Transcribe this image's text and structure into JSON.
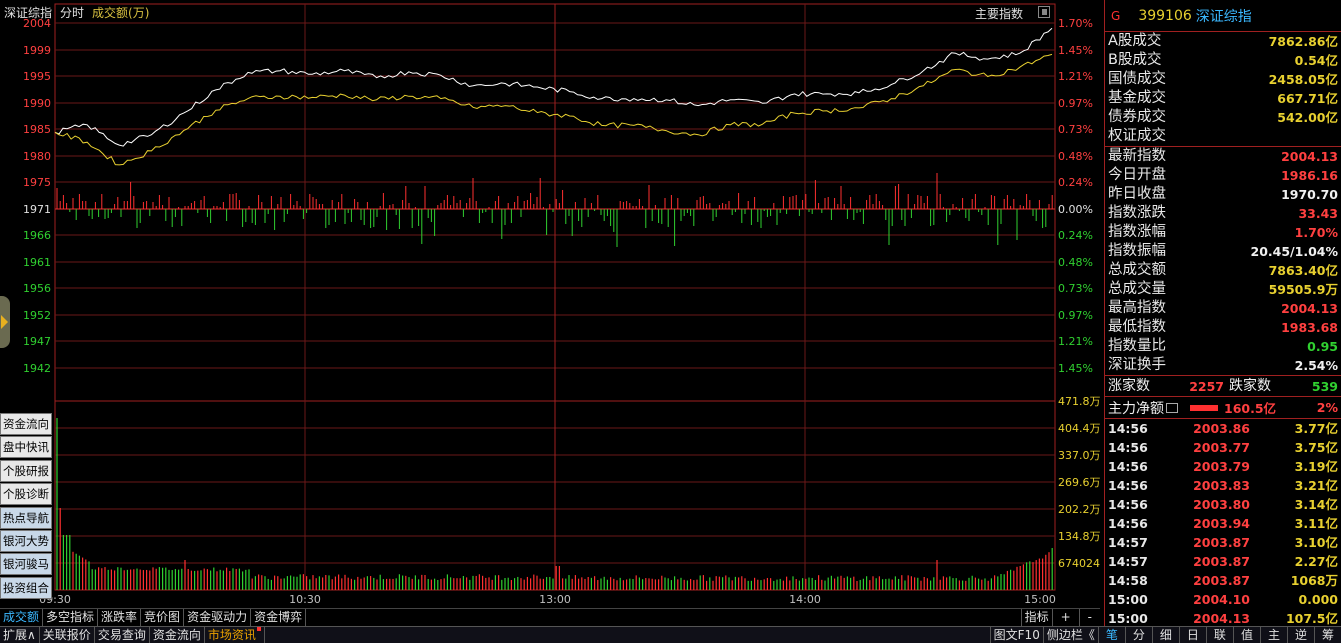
{
  "header": {
    "name": "深证综指",
    "period": "分时",
    "volume_label": "成交额(万)",
    "main_index_btn": "主要指数"
  },
  "price_axis": {
    "left": [
      "2004",
      "1999",
      "1995",
      "1990",
      "1985",
      "1980",
      "1975",
      "1971",
      "1966",
      "1961",
      "1956",
      "1952",
      "1947",
      "1942"
    ],
    "right": [
      "1.70%",
      "1.45%",
      "1.21%",
      "0.97%",
      "0.73%",
      "0.48%",
      "0.24%",
      "0.00%",
      "0.24%",
      "0.48%",
      "0.73%",
      "0.97%",
      "1.21%",
      "1.45%"
    ]
  },
  "volume_axis": {
    "right": [
      "471.8万",
      "404.4万",
      "337.0万",
      "269.6万",
      "202.2万",
      "134.8万",
      "674024"
    ]
  },
  "time_axis": [
    "09:30",
    "10:30",
    "13:00",
    "14:00",
    "15:00"
  ],
  "side_buttons": [
    "资金流向",
    "盘中快讯",
    "个股研报",
    "个股诊断",
    "热点导航",
    "银河大势",
    "银河骏马",
    "投资组合"
  ],
  "tabs": [
    "成交额",
    "多空指标",
    "涨跌率",
    "竞价图",
    "资金驱动力",
    "资金博弈"
  ],
  "tabs_right": [
    "指标",
    "+",
    "-"
  ],
  "bottom_bar": {
    "left": [
      "扩展∧",
      "关联报价",
      "交易查询",
      "资金流向",
      "市场资讯"
    ],
    "right": [
      "图文F10",
      "侧边栏《",
      "笔",
      "分",
      "细",
      "日",
      "联",
      "值",
      "主",
      "逆",
      "筹"
    ]
  },
  "security": {
    "flag": "G",
    "code": "399106",
    "name": "深证综指"
  },
  "turnover": [
    {
      "k": "A股成交",
      "v": "7862.86亿"
    },
    {
      "k": "B股成交",
      "v": "0.54亿"
    },
    {
      "k": "国债成交",
      "v": "2458.05亿"
    },
    {
      "k": "基金成交",
      "v": "667.71亿"
    },
    {
      "k": "债券成交",
      "v": "542.00亿"
    },
    {
      "k": "权证成交",
      "v": ""
    }
  ],
  "stats": [
    {
      "k": "最新指数",
      "v": "2004.13",
      "c": "r"
    },
    {
      "k": "今日开盘",
      "v": "1986.16",
      "c": "r"
    },
    {
      "k": "昨日收盘",
      "v": "1970.70",
      "c": "w"
    },
    {
      "k": "指数涨跌",
      "v": "33.43",
      "c": "r"
    },
    {
      "k": "指数涨幅",
      "v": "1.70%",
      "c": "r"
    },
    {
      "k": "指数振幅",
      "v": "20.45/1.04%",
      "c": "w"
    },
    {
      "k": "总成交额",
      "v": "7863.40亿",
      "c": "y"
    },
    {
      "k": "总成交量",
      "v": "59505.9万",
      "c": "y"
    },
    {
      "k": "最高指数",
      "v": "2004.13",
      "c": "r"
    },
    {
      "k": "最低指数",
      "v": "1983.68",
      "c": "r"
    },
    {
      "k": "指数量比",
      "v": "0.95",
      "c": "gr"
    },
    {
      "k": "深证换手",
      "v": "2.54%",
      "c": "w"
    }
  ],
  "breadth": {
    "up_label": "涨家数",
    "up": "2257",
    "down_label": "跌家数",
    "down": "539"
  },
  "main_flow": {
    "label": "主力净额",
    "value": "160.5亿",
    "pct": "2%"
  },
  "ticks": [
    {
      "t": "14:56",
      "p": "2003.86",
      "a": "3.77亿"
    },
    {
      "t": "14:56",
      "p": "2003.77",
      "a": "3.75亿"
    },
    {
      "t": "14:56",
      "p": "2003.79",
      "a": "3.19亿"
    },
    {
      "t": "14:56",
      "p": "2003.83",
      "a": "3.21亿"
    },
    {
      "t": "14:56",
      "p": "2003.80",
      "a": "3.14亿"
    },
    {
      "t": "14:56",
      "p": "2003.94",
      "a": "3.11亿"
    },
    {
      "t": "14:57",
      "p": "2003.87",
      "a": "3.10亿"
    },
    {
      "t": "14:57",
      "p": "2003.87",
      "a": "2.27亿"
    },
    {
      "t": "14:58",
      "p": "2003.87",
      "a": "1068万"
    },
    {
      "t": "15:00",
      "p": "2004.10",
      "a": "0.000"
    },
    {
      "t": "15:00",
      "p": "2004.13",
      "a": "107.5亿"
    }
  ],
  "chart_data": {
    "type": "line",
    "title": "深证综指 分时",
    "prev_close": 1970.7,
    "ylim": [
      1940,
      2005
    ],
    "series": [
      {
        "name": "index",
        "color": "#ffffff",
        "x": [
          "09:30",
          "09:35",
          "09:40",
          "09:45",
          "09:50",
          "09:55",
          "10:00",
          "10:05",
          "10:10",
          "10:15",
          "10:20",
          "10:25",
          "10:30",
          "10:40",
          "10:50",
          "11:00",
          "11:10",
          "11:20",
          "11:30",
          "13:00",
          "13:10",
          "13:20",
          "13:30",
          "13:40",
          "13:50",
          "14:00",
          "14:10",
          "14:20",
          "14:30",
          "14:40",
          "14:50",
          "15:00"
        ],
        "values": [
          1986.2,
          1987.5,
          1984.0,
          1985.8,
          1989.5,
          1993.5,
          1996.5,
          1996.8,
          1996.2,
          1996.8,
          1995.6,
          1996.6,
          1996.0,
          1994.2,
          1994.6,
          1994.0,
          1993.2,
          1992.0,
          1992.0,
          1991.8,
          1990.8,
          1991.8,
          1991.2,
          1992.8,
          1992.8,
          1993.0,
          1994.4,
          1996.8,
          1999.8,
          1998.8,
          1999.8,
          2004.1
        ]
      },
      {
        "name": "avg",
        "color": "#e8d030",
        "x": [
          "09:30",
          "09:35",
          "09:40",
          "09:45",
          "09:50",
          "09:55",
          "10:00",
          "10:05",
          "10:10",
          "10:15",
          "10:20",
          "10:25",
          "10:30",
          "10:40",
          "10:50",
          "11:00",
          "11:10",
          "11:20",
          "11:30",
          "13:00",
          "13:10",
          "13:20",
          "13:30",
          "13:40",
          "13:50",
          "14:00",
          "14:10",
          "14:20",
          "14:30",
          "14:40",
          "14:50",
          "15:00"
        ],
        "values": [
          1986.2,
          1984.5,
          1980.6,
          1983.0,
          1986.5,
          1990.0,
          1992.0,
          1992.4,
          1992.2,
          1992.6,
          1991.8,
          1992.4,
          1992.0,
          1990.5,
          1990.8,
          1989.6,
          1989.0,
          1987.4,
          1987.4,
          1986.5,
          1985.8,
          1987.5,
          1987.6,
          1989.5,
          1989.9,
          1990.4,
          1992.0,
          1994.2,
          1997.0,
          1995.8,
          1997.4,
          1999.6
        ]
      }
    ],
    "volume_ylim": [
      0,
      4718000
    ]
  }
}
